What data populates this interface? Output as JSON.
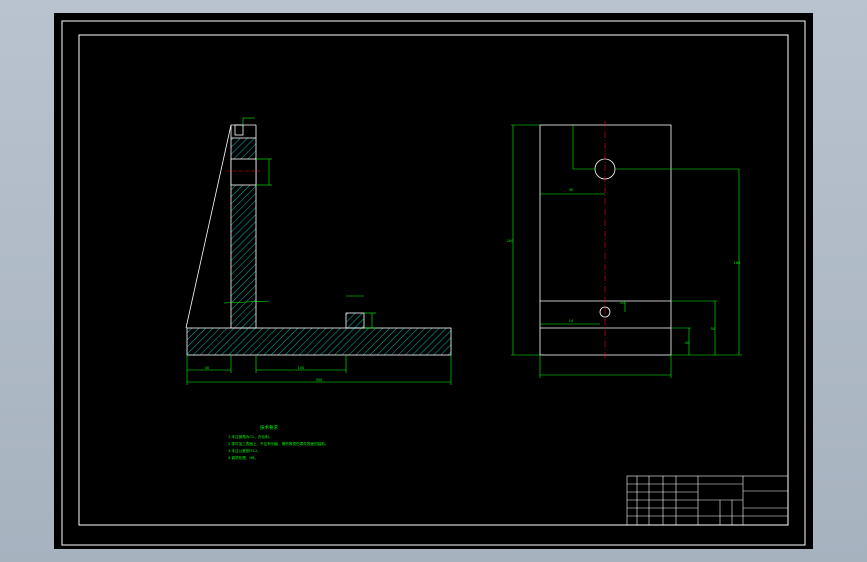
{
  "technical_requirements": {
    "title": "技术要求",
    "lines": [
      "1.未注倒角为C1，去毛刺。",
      "2.零件加工表面上，不应有划痕、擦伤等损伤零件表面的缺陷。",
      "3.未注公差按IT12。",
      "4.调质处理，HB。"
    ]
  },
  "colors": {
    "background": "#000000",
    "frame": "#ffffff",
    "dimension": "#00ff00",
    "centerline": "#ff0000",
    "hatch": "#00ffff"
  },
  "dimensions_left": [
    "40",
    "100",
    "300"
  ],
  "dimensions_right": [
    "30",
    "200",
    "14",
    "160",
    "50",
    "40"
  ]
}
